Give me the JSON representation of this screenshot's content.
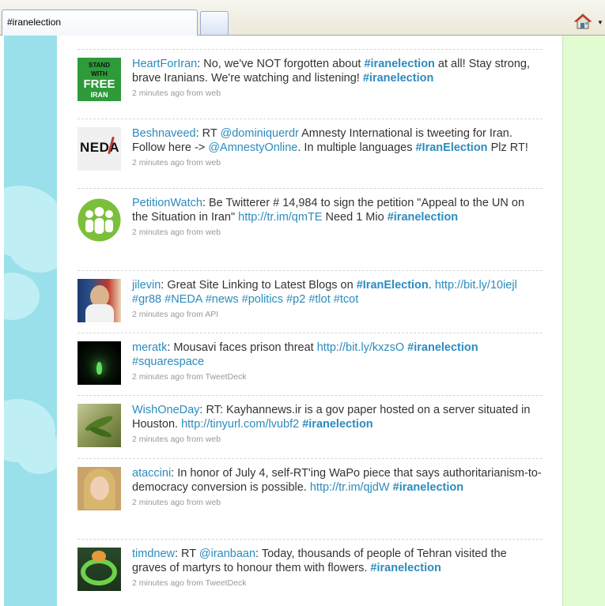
{
  "browser": {
    "tab_title": "#iranelection",
    "home_icon": "home-icon"
  },
  "colors": {
    "link": "#2c8bbd",
    "left_bg": "#9ae0ea",
    "right_bg": "#e0fcd0"
  },
  "tweets": [
    {
      "user": "HeartForIran",
      "avatar_icon": "stand-with-free-iran-avatar",
      "avatar_text": [
        "STAND",
        "WITH",
        "FREE",
        "IRAN"
      ],
      "parts": [
        ": No, we've NOT forgotten about ",
        "#iranelection",
        " at all! Stay strong, brave Iranians. We're watching and listening! ",
        "#iranelection"
      ],
      "meta": "2 minutes ago from web"
    },
    {
      "user": "Beshnaveed",
      "avatar_icon": "neda-avatar",
      "avatar_text": [
        "NEDA"
      ],
      "parts": [
        ": RT ",
        "@dominiquerdr",
        " Amnesty International is tweeting for Iran. Follow here -> ",
        "@AmnestyOnline",
        ". In multiple languages ",
        "#IranElection",
        " Plz RT!"
      ],
      "meta": "2 minutes ago from web"
    },
    {
      "user": "PetitionWatch",
      "avatar_icon": "people-avatar",
      "parts": [
        ": Be Twitterer # 14,984 to sign the petition \"Appeal to the UN on the Situation in Iran\" ",
        "http://tr.im/qmTE",
        " Need 1 Mio ",
        "#iranelection"
      ],
      "meta": "2 minutes ago from web"
    },
    {
      "user": "jilevin",
      "avatar_icon": "poster-portrait-avatar",
      "parts": [
        ": Great Site Linking to Latest Blogs on ",
        "#IranElection",
        ". ",
        "http://bit.ly/10iejl",
        " ",
        "#gr88",
        " ",
        "#NEDA",
        " ",
        "#news",
        " ",
        "#politics",
        " ",
        "#p2",
        " ",
        "#tlot",
        " ",
        "#tcot"
      ],
      "meta": "2 minutes ago from API"
    },
    {
      "user": "meratk",
      "avatar_icon": "candle-avatar",
      "parts": [
        ": Mousavi faces prison threat ",
        "http://bit.ly/kxzsO",
        " ",
        "#iranelection",
        " ",
        "#squarespace"
      ],
      "meta": "2 minutes ago from TweetDeck"
    },
    {
      "user": "WishOneDay",
      "avatar_icon": "plant-avatar",
      "parts": [
        ": RT: Kayhannews.ir is a gov paper hosted on a server situated in Houston. ",
        "http://tinyurl.com/lvubf2",
        " ",
        "#iranelection"
      ],
      "meta": "2 minutes ago from web"
    },
    {
      "user": "ataccini",
      "avatar_icon": "blonde-woman-avatar",
      "parts": [
        ": In honor of July 4, self-RT'ing WaPo piece that says authoritarianism-to-democracy conversion is possible. ",
        "http://tr.im/qjdW",
        " ",
        "#iranelection"
      ],
      "meta": "2 minutes ago from web"
    },
    {
      "user": "timdnew",
      "avatar_icon": "green-ring-avatar",
      "parts": [
        ": RT ",
        "@iranbaan",
        ": Today, thousands of people of Tehran visited the graves of martyrs to honour them with flowers. ",
        "#iranelection"
      ],
      "meta": "2 minutes ago from TweetDeck"
    }
  ]
}
